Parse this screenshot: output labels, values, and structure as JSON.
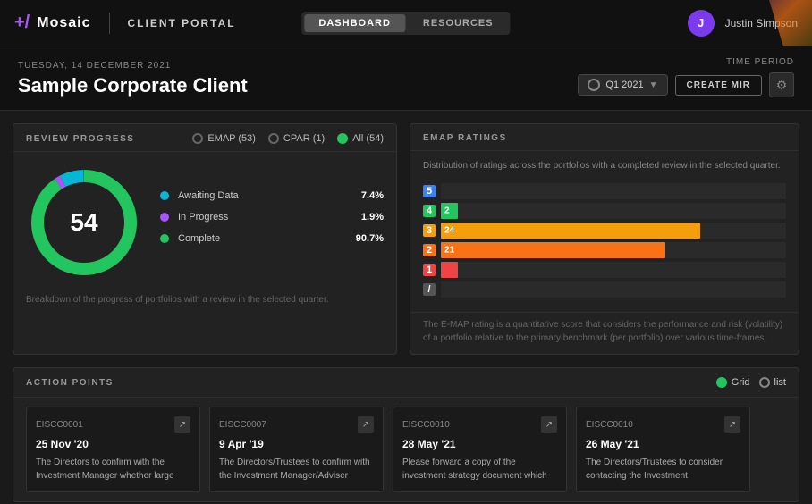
{
  "header": {
    "logo_text": "Mosaic",
    "logo_icon": "+/",
    "portal_label": "CLIENT PORTAL",
    "nav_dashboard": "DASHBOARD",
    "nav_resources": "RESOURCES",
    "user_initial": "J",
    "user_name": "Justin Simpson"
  },
  "sub_header": {
    "date_label": "TUESDAY, 14 DECEMBER 2021",
    "page_title": "Sample Corporate Client",
    "time_period_label": "TIME PERIOD",
    "period_value": "Q1 2021",
    "create_mir_label": "CREATE MIR"
  },
  "review_progress": {
    "title": "REVIEW PROGRESS",
    "filters": [
      {
        "id": "emap",
        "label": "EMAP (53)"
      },
      {
        "id": "cpar",
        "label": "CPAR (1)"
      },
      {
        "id": "all",
        "label": "All (54)"
      }
    ],
    "donut_center": "54",
    "legend": [
      {
        "id": "awaiting",
        "color": "#06b6d4",
        "label": "Awaiting Data",
        "pct": "7.4%"
      },
      {
        "id": "inprogress",
        "color": "#a855f7",
        "label": "In Progress",
        "pct": "1.9%"
      },
      {
        "id": "complete",
        "color": "#22c55e",
        "label": "Complete",
        "pct": "90.7%"
      }
    ],
    "note": "Breakdown of the progress of portfolios with a review in the selected quarter."
  },
  "emap_ratings": {
    "title": "EMAP RATINGS",
    "subtitle": "Distribution of ratings across the portfolios with a completed review in the selected quarter.",
    "bars": [
      {
        "id": "r5",
        "label": "5",
        "value": 0,
        "display": "",
        "pct": 0,
        "color": "#3b82f6",
        "class": "l5"
      },
      {
        "id": "r4",
        "label": "4",
        "value": 2,
        "display": "2",
        "pct": 3,
        "color": "#22c55e",
        "class": "l4"
      },
      {
        "id": "r3",
        "label": "3",
        "value": 24,
        "display": "24",
        "pct": 49,
        "color": "#f59e0b",
        "class": "l3"
      },
      {
        "id": "r2",
        "label": "2",
        "value": 21,
        "display": "21",
        "pct": 43,
        "color": "#f97316",
        "class": "l2"
      },
      {
        "id": "r1",
        "label": "1",
        "value": 2,
        "display": "",
        "pct": 3,
        "color": "#ef4444",
        "class": "l1"
      },
      {
        "id": "rn",
        "label": "/",
        "value": 0,
        "display": "",
        "pct": 0,
        "color": "#555",
        "class": "ln"
      }
    ],
    "footer": "The E-MAP rating is a quantitative score that considers the performance and risk (volatility) of a portfolio relative to the primary benchmark (per portfolio) over various time-frames."
  },
  "action_points": {
    "title": "ACTION POINTS",
    "view_grid": "Grid",
    "view_list": "list",
    "cards": [
      {
        "id": "EISCC0001",
        "date": "25 Nov '20",
        "text": "The Directors to confirm with the Investment Manager whether large"
      },
      {
        "id": "EISCC0007",
        "date": "9 Apr '19",
        "text": "The Directors/Trustees to confirm with the Investment Manager/Adviser"
      },
      {
        "id": "EISCC0010",
        "date": "28 May '21",
        "text": "Please forward a copy of the investment strategy document which"
      },
      {
        "id": "EISCC0010",
        "date": "26 May '21",
        "text": "The Directors/Trustees to consider contacting the Investment"
      }
    ]
  }
}
